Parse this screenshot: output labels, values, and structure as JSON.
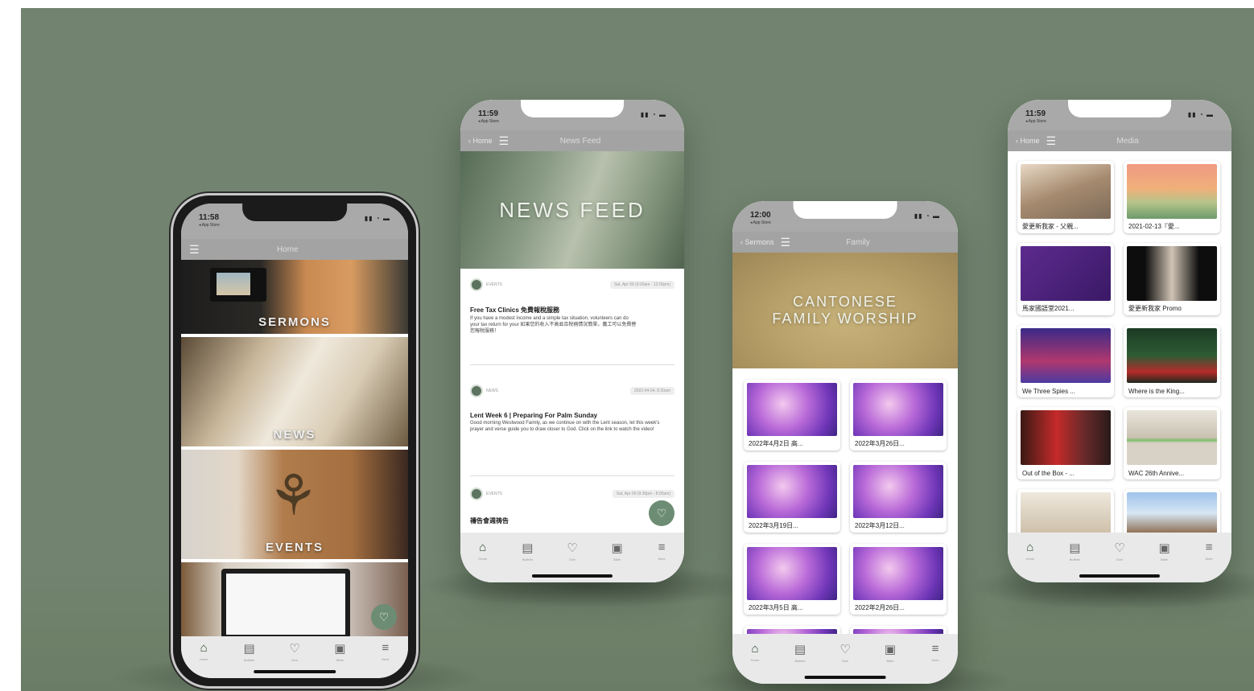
{
  "phone_home": {
    "time": "11:58",
    "store": "◂ App Store",
    "nav_title": "Home",
    "tiles": [
      "SERMONS",
      "NEWS",
      "EVENTS"
    ]
  },
  "phone_news": {
    "time": "11:59",
    "store": "◂ App Store",
    "back": "Home",
    "nav_title": "News Feed",
    "hero": "NEWS FEED",
    "items": [
      {
        "category": "EVENTS",
        "date": "Sat, Apr 09 (9:00am - 12:00pm)",
        "title": "Free Tax Clinics 免費報稅服務",
        "body": "If you have a modest income and a simple tax situation, volunteers can do your tax return for your 如果您的收入不高並且稅務情況簡單，義工可以免費替您報稅服務！"
      },
      {
        "category": "NEWS",
        "date": "2022-04-04, 8:20am",
        "title": "Lent Week 6 | Preparing For Palm Sunday",
        "body": "Good morning Westwood Family, as we continue on with the Lent season, let this week's prayer and verse guide you to draw closer to God. Click on the link to watch the video!"
      },
      {
        "category": "EVENTS",
        "date": "Sat, Apr 09 (9:30pm - 8:00am)",
        "title": "禱告會週祷告",
        "body": ""
      }
    ]
  },
  "phone_family": {
    "time": "12:00",
    "store": "◂ App Store",
    "back": "Sermons",
    "nav_title": "Family",
    "hero": "CANTONESE FAMILY WORSHIP",
    "videos": [
      "2022年4月2日 高...",
      "2022年3月26日...",
      "2022年3月19日...",
      "2022年3月12日...",
      "2022年3月5日 高...",
      "2022年2月26日..."
    ]
  },
  "phone_media": {
    "time": "11:59",
    "store": "◂ App Store",
    "back": "Home",
    "nav_title": "Media",
    "items": [
      "愛更新我家 - 父親...",
      "2021-02-13『愛...",
      "馬家國語堂2021...",
      "愛更新我家 Promo",
      "We Three Spies ...",
      "Where is the King...",
      "Out of the Box - ...",
      "WAC 26th Annive...",
      "",
      ""
    ]
  },
  "tabs": [
    "Home",
    "Bulletin",
    "Give",
    "Bible",
    "More"
  ],
  "icons": {
    "tab_home": "⌂",
    "tab_bulletin": "▤",
    "tab_give": "♡",
    "tab_bible": "▣",
    "tab_more": "≡",
    "heart": "♡",
    "menu": "☰",
    "back": "‹",
    "signal": "▮▮ ◔ ▬"
  },
  "colors": {
    "backdrop": "#728470",
    "navbar": "#a3a3a3",
    "accent": "#6d8c74"
  }
}
